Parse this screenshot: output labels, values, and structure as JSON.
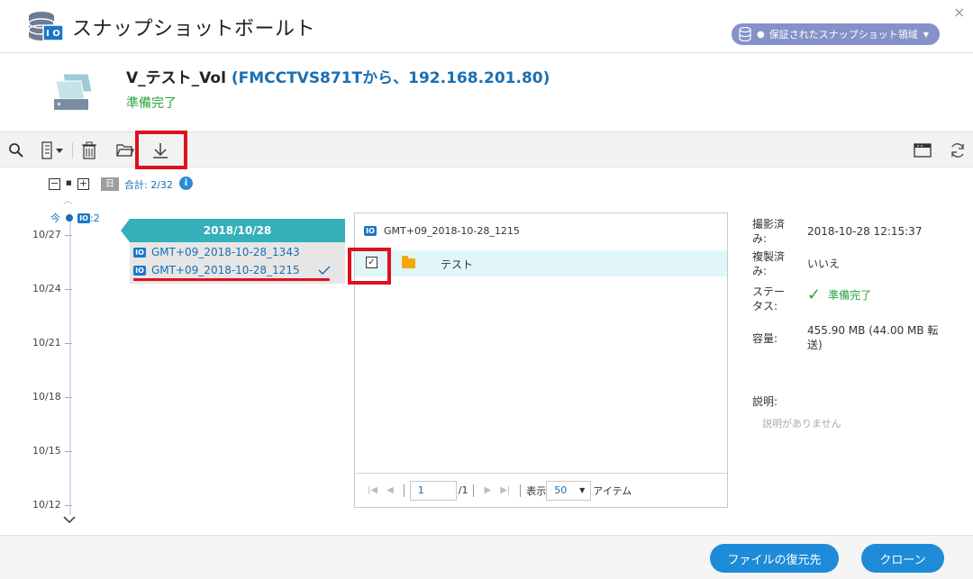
{
  "header": {
    "title": "スナップショットボールト",
    "area_label": "保証されたスナップショット領域",
    "close": "×"
  },
  "volume": {
    "name": "V_テスト_Vol",
    "source": "(FMCCTVS871Tから、192.168.201.80)",
    "status": "準備完了"
  },
  "toolbar": {
    "left_icons": [
      "search-icon",
      "view-mode-icon",
      "delete-icon",
      "open-folder-icon",
      "download-icon"
    ],
    "right_icons": [
      "window-icon",
      "refresh-icon"
    ]
  },
  "controls": {
    "collapse": "−",
    "dot": "■",
    "expand": "+",
    "day_chip": "日",
    "total": "合計: 2/32",
    "info": "i"
  },
  "timeline": {
    "now_label": "今",
    "now_count": ":2",
    "ticks": [
      "10/27",
      "10/24",
      "10/21",
      "10/18",
      "10/15",
      "10/12"
    ]
  },
  "date_card": {
    "date": "2018/10/28",
    "snapshots": [
      {
        "name": "GMT+09_2018-10-28_1343",
        "selected": false
      },
      {
        "name": "GMT+09_2018-10-28_1215",
        "selected": true
      }
    ]
  },
  "file_panel": {
    "snapshot_name": "GMT+09_2018-10-28_1215",
    "files": [
      {
        "name": "テスト",
        "type": "folder",
        "checked": true
      }
    ],
    "pager": {
      "page": "1",
      "total_pages": "/1",
      "show_label": "表示",
      "per_page": "50",
      "items_label": "アイテム"
    }
  },
  "info": {
    "taken_label": "撮影済み:",
    "taken_value": "2018-10-28 12:15:37",
    "replicated_label": "複製済み:",
    "replicated_value": "いいえ",
    "status_label": "ステータス:",
    "status_value": "準備完了",
    "capacity_label": "容量:",
    "capacity_value": "455.90 MB (44.00 MB 転送)",
    "description_label": "説明:",
    "description_value": "説明がありません"
  },
  "footer": {
    "restore_label": "ファイルの復元先",
    "clone_label": "クローン"
  },
  "colors": {
    "accent": "#1e8bd8",
    "ready_green": "#29a33c",
    "date_header": "#35b0bb",
    "highlight_red": "#e0101c",
    "area_pill": "#8591c9"
  }
}
